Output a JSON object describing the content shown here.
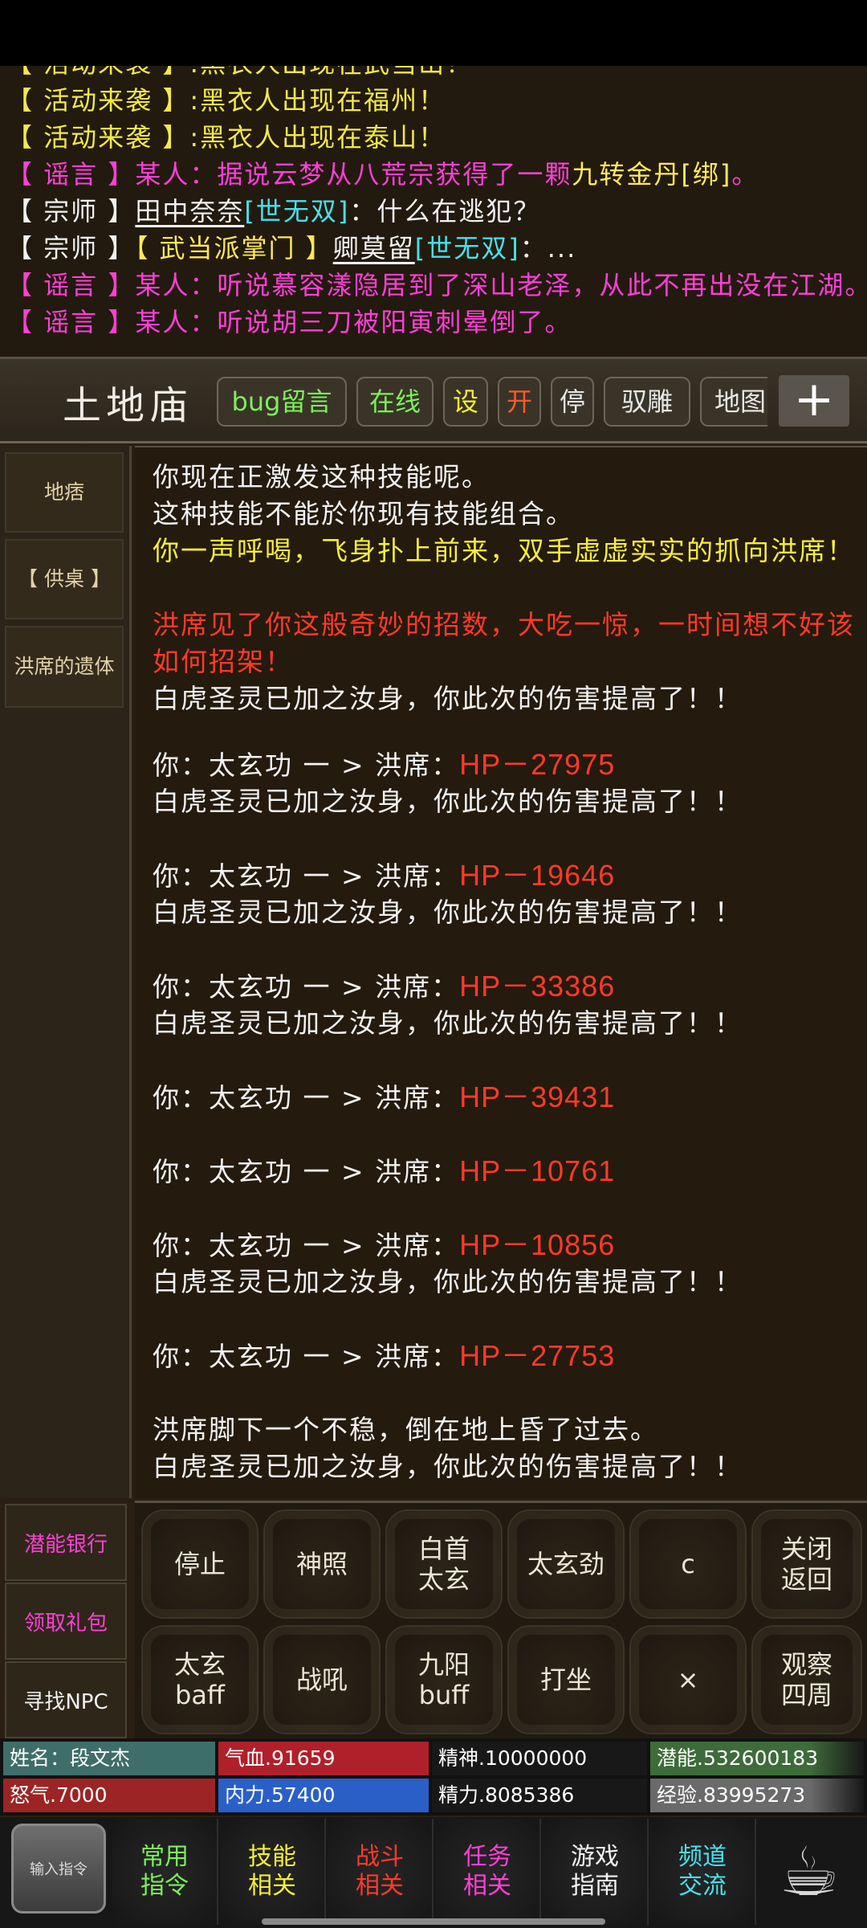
{
  "chat": {
    "lines": [
      {
        "a": "【 活动来袭 】:黑衣人出现在武当山！"
      },
      {
        "a": "【 活动来袭 】:黑衣人出现在福州！"
      },
      {
        "a": "【 活动来袭 】:黑衣人出现在泰山！"
      },
      {
        "a": "【 谣言 】某人：据说云梦从八荒宗获得了一颗",
        "b": "九转金丹[绑]",
        "c": "。"
      },
      {
        "a": "【 宗师 】",
        "b": "田中奈奈",
        "c": "[世无双]",
        "d": "：什么在逃犯？"
      },
      {
        "a": "【 宗师 】",
        "b": "【 武当派掌门 】",
        "c": "卿莫留",
        "d": "[世无双]",
        "e": "：..."
      },
      {
        "a": "【 谣言 】某人：听说慕容漾隐居到了深山老泽，从此不再出没在江湖。"
      },
      {
        "a": "【 谣言 】某人：听说胡三刀被阳寅刺晕倒了。"
      }
    ]
  },
  "room": {
    "title": "土地庙",
    "buttons": [
      "bug留言",
      "在线",
      "设",
      "开",
      "停",
      "驭雕",
      "地图"
    ],
    "plus": "+"
  },
  "sidebar": {
    "items": [
      "地痞",
      "【 供桌 】",
      "洪席的遗体"
    ],
    "links": [
      "潜能银行",
      "领取礼包",
      "寻找NPC"
    ]
  },
  "log": {
    "l1": "你现在正激发这种技能呢。",
    "l2": "这种技能不能於你现有技能组合。",
    "l3": "你一声呼喝，飞身扑上前来，双手虚虚实实的抓向洪席！",
    "l4": "洪席见了你这般奇妙的招数，大吃一惊，一时间想不好该如何招架！",
    "buff": "白虎圣灵已加之汝身，你此次的伤害提高了！！",
    "attack_prefix": "你：太玄功 一 > 洪席：",
    "hits": [
      "HP－27975",
      "HP－19646",
      "HP－33386",
      "HP－39431",
      "HP－10761",
      "HP－10856",
      "HP－27753"
    ],
    "end": "洪席脚下一个不稳，倒在地上昏了过去。"
  },
  "skills": {
    "row1": [
      "停止",
      "神照",
      "白首\n太玄",
      "太玄劲",
      "c",
      "关闭\n返回"
    ],
    "row2": [
      "太玄\nbaff",
      "战吼",
      "九阳\nbuff",
      "打坐",
      "×",
      "观察\n四周"
    ]
  },
  "stats": {
    "name": "姓名：段文杰",
    "qixue": "气血.91659",
    "jingshen": "精神.10000000",
    "qianneng": "潜能.532600183",
    "nuqi": "怒气.7000",
    "neili": "内力.57400",
    "jingli": "精力.8085386",
    "jingyan": "经验.83995273"
  },
  "nav": {
    "input": "输入指令",
    "items": [
      {
        "label": "常用\n指令",
        "color": "#7cf05a"
      },
      {
        "label": "技能\n相关",
        "color": "#f4ee3c"
      },
      {
        "label": "战斗\n相关",
        "color": "#ff3a2a"
      },
      {
        "label": "任务\n相关",
        "color": "#ff3fd7"
      },
      {
        "label": "游戏\n指南",
        "color": "#f2f2f2"
      },
      {
        "label": "频道\n交流",
        "color": "#49e0ee"
      }
    ]
  }
}
